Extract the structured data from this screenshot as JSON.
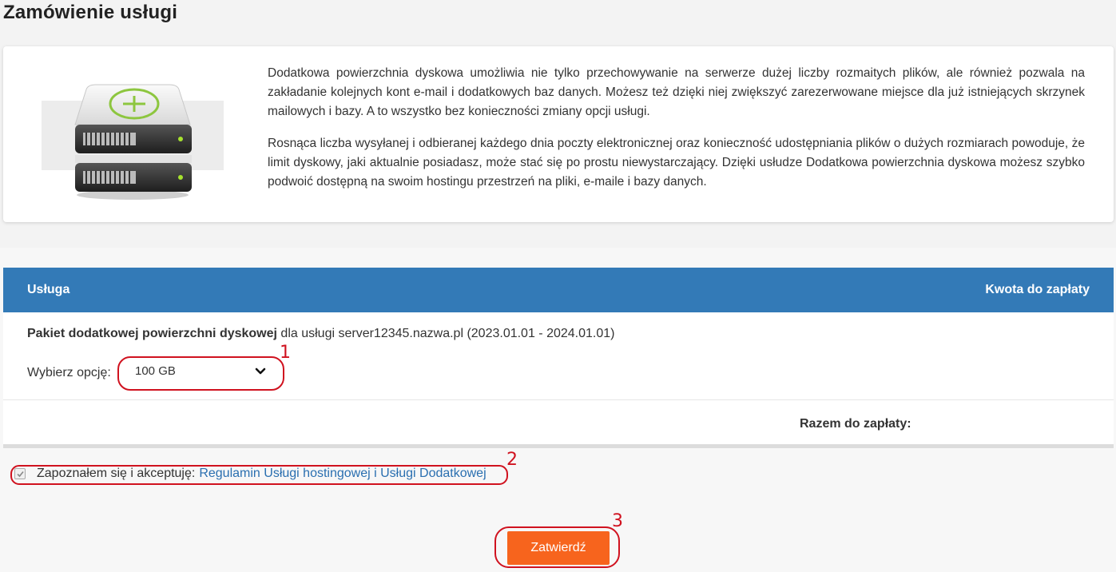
{
  "page": {
    "title": "Zamówienie usługi"
  },
  "info": {
    "illustration_icon": "disk-add-icon",
    "paragraphs": [
      "Dodatkowa powierzchnia dyskowa umożliwia nie tylko przechowywanie na serwerze dużej liczby rozmaitych plików, ale również pozwala na zakładanie kolejnych kont e-mail i dodatkowych baz danych. Możesz też dzięki niej zwiększyć zarezerwowane miejsce dla już istniejących skrzynek mailowych i bazy. A to wszystko bez konieczności zmiany opcji usługi.",
      "Rosnąca liczba wysyłanej i odbieranej każdego dnia poczty elektronicznej oraz konieczność udostępniania plików o dużych rozmiarach powoduje, że limit dyskowy, jaki aktualnie posiadasz, może stać się po prostu niewystarczający. Dzięki usłudze Dodatkowa powierzchnia dyskowa możesz szybko podwoić dostępną na swoim hostingu przestrzeń na pliki, e-maile i bazy danych."
    ]
  },
  "order": {
    "header": {
      "service": "Usługa",
      "amount": "Kwota do zapłaty"
    },
    "service": {
      "name": "Pakiet dodatkowej powierzchni dyskowej",
      "details": " dla usługi server12345.nazwa.pl (2023.01.01 - 2024.01.01)",
      "option_label": "Wybierz opcję:",
      "option_value": "100 GB"
    },
    "total_label": "Razem do zapłaty:"
  },
  "terms": {
    "checked": true,
    "text": "Zapoznałem się i akceptuję:",
    "link": "Regulamin Usługi hostingowej i Usługi Dodatkowej"
  },
  "submit_label": "Zatwierdź",
  "annotations": [
    "1",
    "2",
    "3"
  ],
  "colors": {
    "header_blue": "#337ab7",
    "button_orange": "#f7641d",
    "annotation_red": "#d0121f",
    "link_blue": "#2a6fb0",
    "plus_green": "#8dc63f"
  }
}
